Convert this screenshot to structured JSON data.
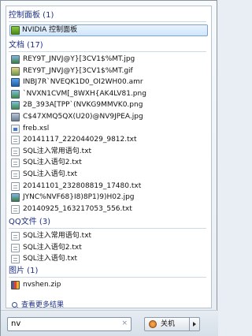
{
  "sections": {
    "control_panel": {
      "title": "控制面板 (1)",
      "items": [
        {
          "label": "NVIDIA 控制面板",
          "icon": "nvidia-icon"
        }
      ]
    },
    "documents": {
      "title": "文档 (17)",
      "items": [
        {
          "label": "REY9T_JNVJ@Y}[3CV1$%MT.jpg",
          "icon": "image-icon"
        },
        {
          "label": "REY9T_JNVJ@Y}[3CV1$%MT.gif",
          "icon": "gif-icon"
        },
        {
          "label": "INBJ7R`NVEQK1D0_OI2WH00.amr",
          "icon": "audio-icon"
        },
        {
          "label": "`NVXN1CVM[_8WXH{AK4LV81.png",
          "icon": "image-icon"
        },
        {
          "label": "2B_393A[TPP`(NVKG9MMVK0.png",
          "icon": "image-icon"
        },
        {
          "label": "C$47XMQ5QX(U20)@NV9JPEA.jpg",
          "icon": "image-icon"
        },
        {
          "label": "freb.xsl",
          "icon": "xsl-icon"
        },
        {
          "label": "20141117_222044029_9812.txt",
          "icon": "text-file-icon"
        },
        {
          "label": "SQL注入常用语句.txt",
          "icon": "text-file-icon"
        },
        {
          "label": "SQL注入语句2.txt",
          "icon": "text-file-icon"
        },
        {
          "label": "SQL注入语句.txt",
          "icon": "text-file-icon"
        },
        {
          "label": "20141101_232808819_17480.txt",
          "icon": "text-file-icon"
        },
        {
          "label": "JYNC%NVF68}I8)8P1)9)H02.jpg",
          "icon": "image-icon"
        },
        {
          "label": "20140925_163217053_556.txt",
          "icon": "text-file-icon"
        }
      ]
    },
    "qq_files": {
      "title": "QQ文件 (3)",
      "items": [
        {
          "label": "SQL注入常用语句.txt",
          "icon": "text-file-icon"
        },
        {
          "label": "SQL注入语句2.txt",
          "icon": "text-file-icon"
        },
        {
          "label": "SQL注入语句.txt",
          "icon": "text-file-icon"
        }
      ]
    },
    "pictures": {
      "title": "图片 (1)",
      "items": [
        {
          "label": "nvshen.zip",
          "icon": "zip-icon"
        }
      ]
    }
  },
  "see_more": "查看更多结果",
  "search": {
    "value": "nv",
    "clear_glyph": "×"
  },
  "shutdown": {
    "label": "关机"
  },
  "colors": {
    "heading": "#1e3287",
    "selection": "#cfe6fb"
  }
}
